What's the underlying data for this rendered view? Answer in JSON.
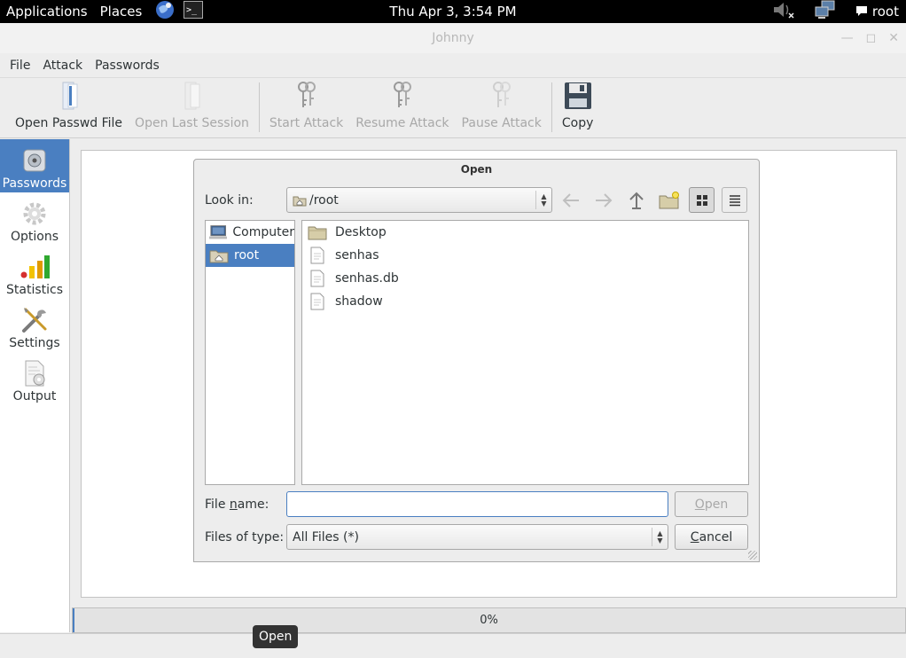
{
  "top_panel": {
    "applications": "Applications",
    "places": "Places",
    "clock": "Thu Apr  3,  3:54 PM",
    "user": "root"
  },
  "window": {
    "title": "Johnny"
  },
  "menubar": {
    "file": "File",
    "attack": "Attack",
    "passwords": "Passwords"
  },
  "toolbar": {
    "open_passwd": "Open Passwd File",
    "open_last_session": "Open Last Session",
    "start_attack": "Start Attack",
    "resume_attack": "Resume Attack",
    "pause_attack": "Pause Attack",
    "copy": "Copy"
  },
  "sidenav": {
    "passwords": "Passwords",
    "options": "Options",
    "statistics": "Statistics",
    "settings": "Settings",
    "output": "Output"
  },
  "dialog": {
    "title": "Open",
    "look_in_label": "Look in:",
    "look_in_value": "/root",
    "places": [
      "Computer",
      "root"
    ],
    "files": [
      {
        "name": "Desktop",
        "type": "folder"
      },
      {
        "name": "senhas",
        "type": "file"
      },
      {
        "name": "senhas.db",
        "type": "file"
      },
      {
        "name": "shadow",
        "type": "file"
      }
    ],
    "file_name_label_pre": "File ",
    "file_name_label_u": "n",
    "file_name_label_post": "ame:",
    "file_name_value": "",
    "files_of_type_label": "Files of type:",
    "files_of_type_value": "All Files (*)",
    "open_u": "O",
    "open_rest": "pen",
    "cancel_u": "C",
    "cancel_rest": "ancel"
  },
  "progress": {
    "text": "0%",
    "value": 0
  },
  "tooltip": {
    "text": "Open"
  },
  "colors": {
    "accent": "#4a7fc1",
    "panel": "#000000"
  }
}
